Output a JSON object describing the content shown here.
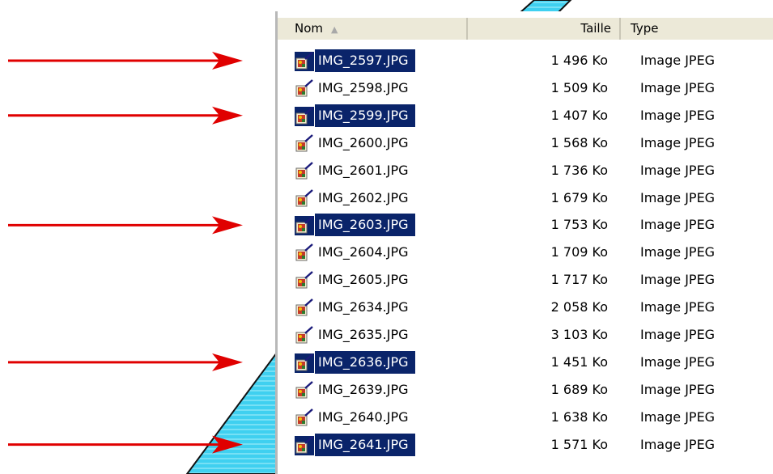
{
  "columns": {
    "name": "Nom",
    "size": "Taille",
    "type": "Type"
  },
  "files": [
    {
      "name": "IMG_2597.JPG",
      "size": "1 496 Ko",
      "type": "Image JPEG",
      "selected": true
    },
    {
      "name": "IMG_2598.JPG",
      "size": "1 509 Ko",
      "type": "Image JPEG",
      "selected": false
    },
    {
      "name": "IMG_2599.JPG",
      "size": "1 407 Ko",
      "type": "Image JPEG",
      "selected": true
    },
    {
      "name": "IMG_2600.JPG",
      "size": "1 568 Ko",
      "type": "Image JPEG",
      "selected": false
    },
    {
      "name": "IMG_2601.JPG",
      "size": "1 736 Ko",
      "type": "Image JPEG",
      "selected": false
    },
    {
      "name": "IMG_2602.JPG",
      "size": "1 679 Ko",
      "type": "Image JPEG",
      "selected": false
    },
    {
      "name": "IMG_2603.JPG",
      "size": "1 753 Ko",
      "type": "Image JPEG",
      "selected": true
    },
    {
      "name": "IMG_2604.JPG",
      "size": "1 709 Ko",
      "type": "Image JPEG",
      "selected": false
    },
    {
      "name": "IMG_2605.JPG",
      "size": "1 717 Ko",
      "type": "Image JPEG",
      "selected": false
    },
    {
      "name": "IMG_2634.JPG",
      "size": "2 058 Ko",
      "type": "Image JPEG",
      "selected": false
    },
    {
      "name": "IMG_2635.JPG",
      "size": "3 103 Ko",
      "type": "Image JPEG",
      "selected": false
    },
    {
      "name": "IMG_2636.JPG",
      "size": "1 451 Ko",
      "type": "Image JPEG",
      "selected": true
    },
    {
      "name": "IMG_2639.JPG",
      "size": "1 689 Ko",
      "type": "Image JPEG",
      "selected": false
    },
    {
      "name": "IMG_2640.JPG",
      "size": "1 638 Ko",
      "type": "Image JPEG",
      "selected": false
    },
    {
      "name": "IMG_2641.JPG",
      "size": "1 571 Ko",
      "type": "Image JPEG",
      "selected": true
    }
  ],
  "colors": {
    "selection": "#0a246a",
    "arrow": "#e00000",
    "stripe": "#33ccee",
    "header_bg": "#ece9d8"
  }
}
